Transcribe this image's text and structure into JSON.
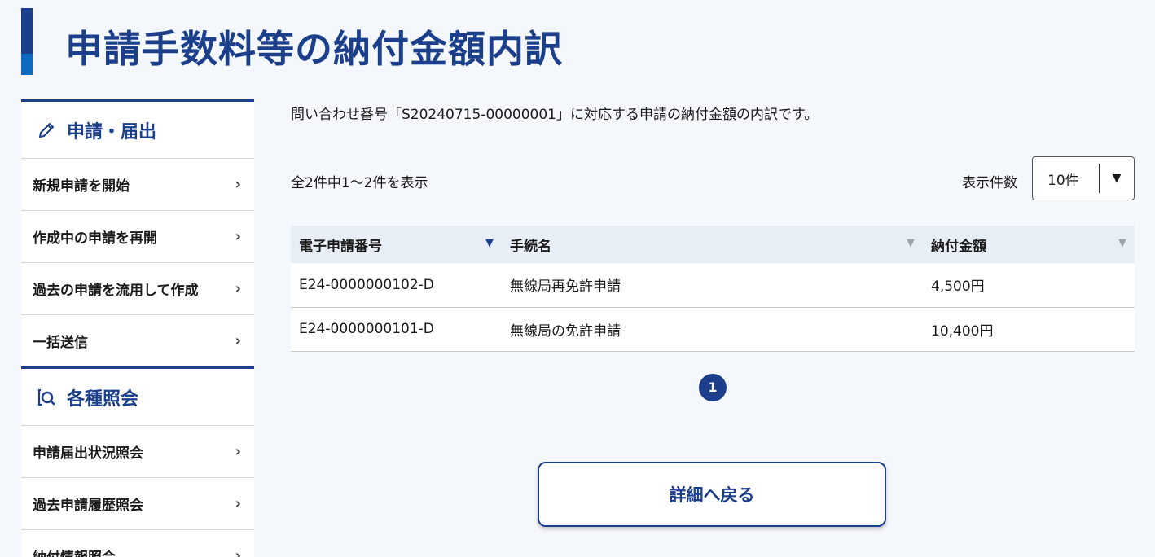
{
  "page": {
    "title": "申請手数料等の納付金額内訳",
    "intro": "問い合わせ番号「S20240715-00000001」に対応する申請の納付金額の内訳です。"
  },
  "sidebar": {
    "sections": [
      {
        "heading": "申請・届出",
        "icon": "pencil-icon",
        "items": [
          "新規申請を開始",
          "作成中の申請を再開",
          "過去の申請を流用して作成",
          "一括送信"
        ]
      },
      {
        "heading": "各種照会",
        "icon": "search-document-icon",
        "items": [
          "申請届出状況照会",
          "過去申請履歴照会",
          "納付情報照会"
        ]
      }
    ]
  },
  "list": {
    "count_text": "全2件中1～2件を表示",
    "per_page_label": "表示件数",
    "per_page_value": "10件",
    "columns": [
      "電子申請番号",
      "手続名",
      "納付金額"
    ],
    "rows": [
      [
        "E24-0000000102-D",
        "無線局再免許申請",
        "4,500円"
      ],
      [
        "E24-0000000101-D",
        "無線局の免許申請",
        "10,400円"
      ]
    ],
    "current_page": "1"
  },
  "actions": {
    "back_label": "詳細へ戻る"
  },
  "colors": {
    "brand": "#1c3f8c",
    "accent": "#0a6bc2",
    "background": "#f4f7fb",
    "table_header": "#e8eef6"
  }
}
